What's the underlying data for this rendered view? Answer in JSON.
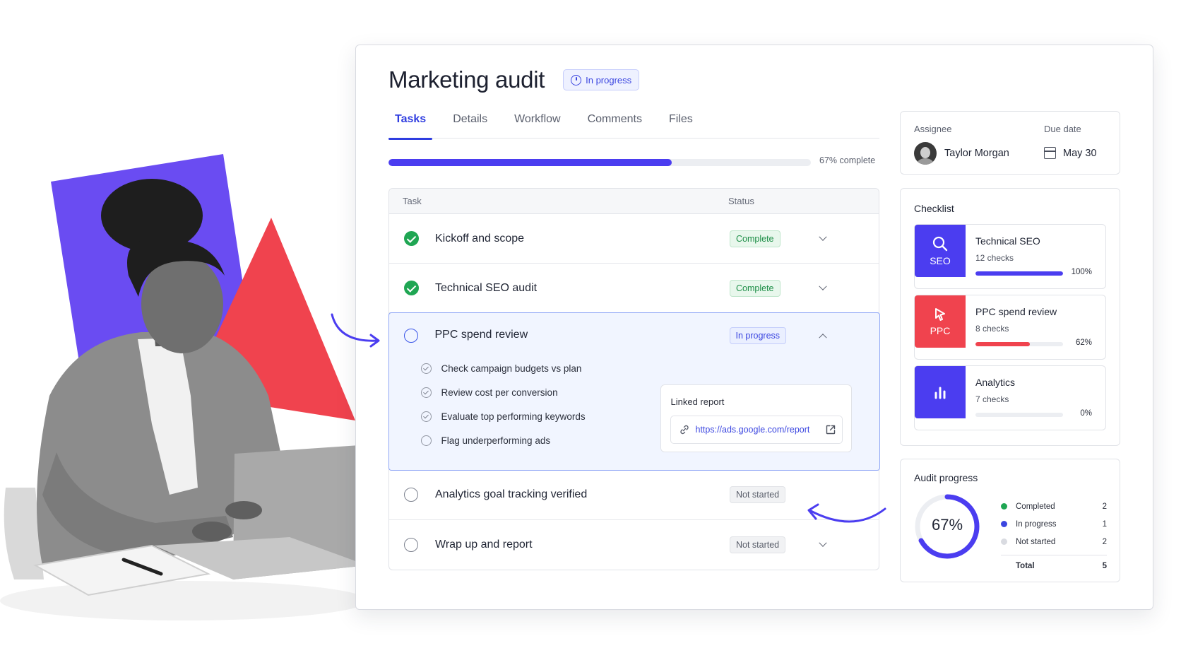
{
  "header": {
    "title": "Marketing audit",
    "status_badge": "In progress"
  },
  "tabs": [
    {
      "label": "Tasks",
      "active": true
    },
    {
      "label": "Details",
      "active": false
    },
    {
      "label": "Workflow",
      "active": false
    },
    {
      "label": "Comments",
      "active": false
    },
    {
      "label": "Files",
      "active": false
    }
  ],
  "progress": {
    "value": 0.67,
    "label": "67% complete"
  },
  "table": {
    "col_task": "Task",
    "col_status": "Status",
    "rows": [
      {
        "name": "Kickoff and scope",
        "status": "Complete",
        "state": "complete"
      },
      {
        "name": "Technical SEO audit",
        "status": "Complete",
        "state": "complete"
      },
      {
        "name": "PPC spend review",
        "status": "In progress",
        "state": "progress",
        "subtasks": [
          {
            "label": "Check campaign budgets vs plan",
            "done": true
          },
          {
            "label": "Review cost per conversion",
            "done": true
          },
          {
            "label": "Evaluate top performing keywords",
            "done": true
          },
          {
            "label": "Flag underperforming ads",
            "done": false
          }
        ],
        "linked_report": {
          "title": "Linked report",
          "url": "https://ads.google.com/report"
        }
      },
      {
        "name": "Analytics goal tracking verified",
        "status": "Not started",
        "state": "notstarted"
      },
      {
        "name": "Wrap up and report",
        "status": "Not started",
        "state": "notstarted"
      }
    ]
  },
  "assignment": {
    "assignee_label": "Assignee",
    "assignee_name": "Taylor Morgan",
    "due_label": "Due date",
    "due_value": "May 30"
  },
  "checklist": {
    "title": "Checklist",
    "items": [
      {
        "tile": "SEO",
        "name": "Technical SEO",
        "count": "12 checks",
        "pct_label": "100%",
        "value": 1.0,
        "color": "#4b3df0",
        "icon": "search-icon"
      },
      {
        "tile": "PPC",
        "name": "PPC spend review",
        "count": "8 checks",
        "pct_label": "62%",
        "value": 0.62,
        "color": "#f0434e",
        "icon": "cursor-icon"
      },
      {
        "tile": "",
        "name": "Analytics",
        "count": "7 checks",
        "pct_label": "0%",
        "value": 0.0,
        "color": "#4b3df0",
        "icon": "bar-chart-icon"
      }
    ]
  },
  "audit_progress": {
    "title": "Audit progress",
    "percent_label": "67%",
    "value": 0.67,
    "legend": [
      {
        "label": "Completed",
        "count": "2",
        "color": "#1fa653"
      },
      {
        "label": "In progress",
        "count": "1",
        "color": "#3b46e0"
      },
      {
        "label": "Not started",
        "count": "2",
        "color": "#d9dbe1"
      }
    ],
    "total_label": "Total",
    "total_count": "5"
  },
  "colors": {
    "accent": "#4b3df0",
    "accent_blue": "#2f3de0",
    "success": "#1fa653",
    "danger": "#f0434e"
  }
}
